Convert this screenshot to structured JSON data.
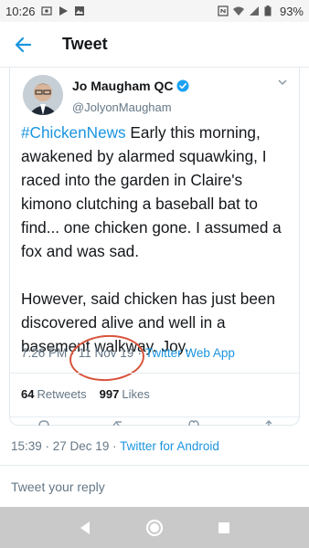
{
  "status_bar": {
    "time": "10:26",
    "battery": "93%",
    "icons": [
      "photo-icon",
      "play-store-icon",
      "photo-icon",
      "nfc-icon",
      "wifi-icon",
      "signal-icon",
      "battery-icon"
    ]
  },
  "header": {
    "title": "Tweet",
    "back_icon": "arrow-left-icon"
  },
  "tweet": {
    "author_name": "Jo Maugham QC",
    "author_handle": "@JolyonMaugham",
    "verified": true,
    "hashtag": "#ChickenNews",
    "text_para1": " Early this morning, awakened by alarmed squawking, I raced into the garden in Claire's kimono clutching a baseball bat to find... one chicken gone. I assumed a fox and was sad.",
    "text_para2": "However, said chicken has just been discovered alive and well in a basement walkway. Joy.",
    "time": "7:26 PM",
    "date": "11 Nov 19",
    "source": "Twitter Web App",
    "separator": "·",
    "retweets": "64",
    "retweets_label": "Retweets",
    "likes": "997",
    "likes_label": "Likes"
  },
  "reply_meta": {
    "text": "15:39 · 27 Dec 19 · ",
    "source": "Twitter for Android"
  },
  "reply_box": {
    "placeholder": "Tweet your reply"
  },
  "colors": {
    "accent": "#1b95e0",
    "muted": "#657786",
    "annotation_circle": "#d9533a",
    "navbar": "#c9c9c9"
  }
}
